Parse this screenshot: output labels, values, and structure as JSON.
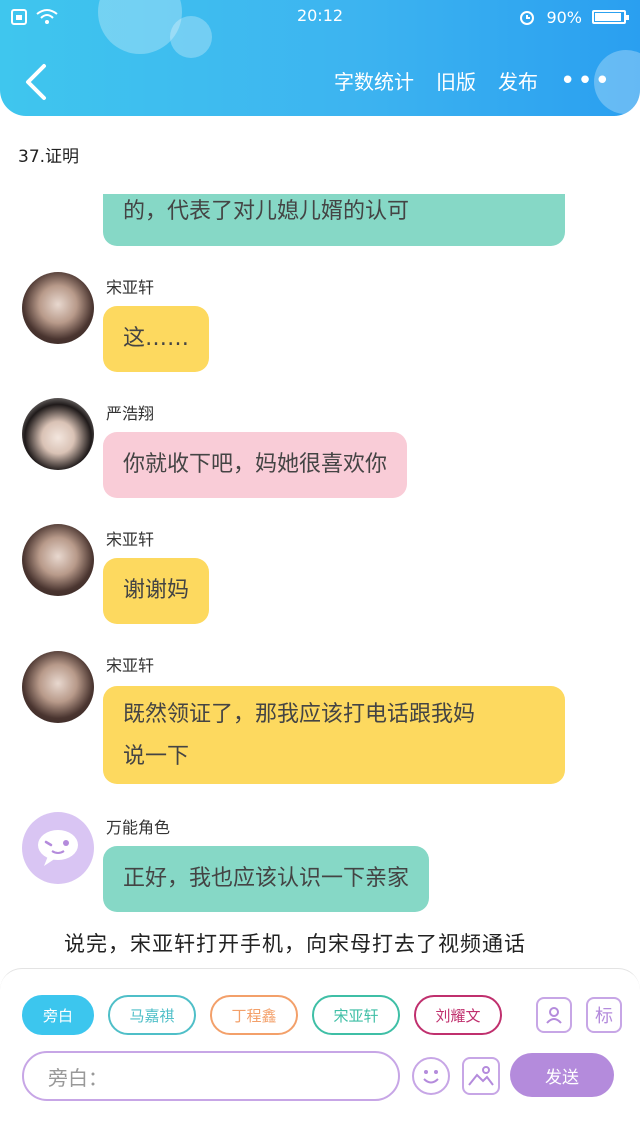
{
  "status_bar": {
    "time": "20:12",
    "battery": "90%"
  },
  "header": {
    "menu": [
      "字数统计",
      "旧版",
      "发布"
    ],
    "more": "•••"
  },
  "chapter_title": "37.证明",
  "messages": [
    {
      "text": "的，代表了对儿媳儿婿的认可",
      "color": "#86d8c6"
    },
    {
      "sender": "宋亚轩",
      "text": "这……",
      "color": "#fdd95f"
    },
    {
      "sender": "严浩翔",
      "text": "你就收下吧，妈她很喜欢你",
      "color": "#f9ccd7"
    },
    {
      "sender": "宋亚轩",
      "text": "谢谢妈",
      "color": "#fdd95f"
    },
    {
      "sender": "宋亚轩",
      "text_line1": "既然领证了，那我应该打电话跟我妈",
      "text_line2": "说一下",
      "color": "#fdd95f"
    },
    {
      "sender": "万能角色",
      "text": "正好，我也应该认识一下亲家",
      "color": "#86d8c6"
    }
  ],
  "narration": "说完，宋亚轩打开手机，向宋母打去了视频通话",
  "roles": [
    {
      "label": "旁白",
      "color": "#3cc6ee",
      "active": true
    },
    {
      "label": "马嘉祺",
      "color": "#4fbfc8"
    },
    {
      "label": "丁程鑫",
      "color": "#f3a06a"
    },
    {
      "label": "宋亚轩",
      "color": "#3fbfa6"
    },
    {
      "label": "刘耀文",
      "color": "#c0306e"
    }
  ],
  "tools": {
    "role_icon": "person-card-icon",
    "tag_label": "标"
  },
  "input": {
    "placeholder": "旁白："
  },
  "send_label": "发送"
}
